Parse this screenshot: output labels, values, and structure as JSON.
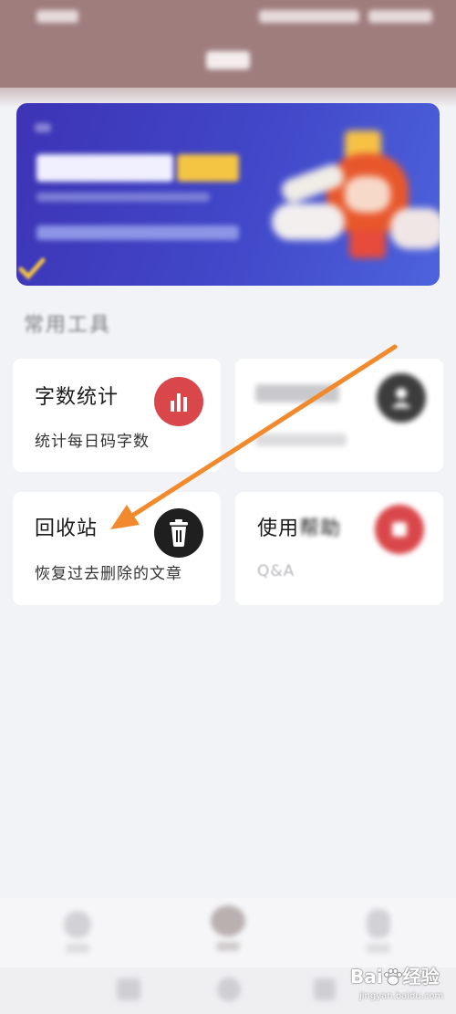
{
  "colors": {
    "header_bg": "#9f7d7d",
    "page_bg": "#f2f3f7",
    "card_bg": "#ffffff",
    "accent_red": "#d9474a",
    "icon_dark": "#1f1f1f",
    "icon_gray": "#3c3c3c",
    "annotation_arrow": "#f08a2c"
  },
  "section_title": "常用工具",
  "tools": [
    {
      "title": "字数统计",
      "subtitle": "统计每日码字数",
      "icon": "bar-chart-icon",
      "icon_color": "#d9474a"
    },
    {
      "title": "",
      "subtitle": "",
      "icon": "person-icon",
      "icon_color": "#3c3c3c"
    },
    {
      "title": "回收站",
      "subtitle": "恢复过去删除的文章",
      "icon": "trash-icon",
      "icon_color": "#1f1f1f"
    },
    {
      "title_clear": "使用",
      "title_blurred": "帮助",
      "subtitle": "Q&A",
      "icon": "help-icon",
      "icon_color": "#d9474a"
    }
  ],
  "watermark": {
    "brand_left": "Bai",
    "brand_right": "经验",
    "url": "jingyan.baidu.com"
  }
}
